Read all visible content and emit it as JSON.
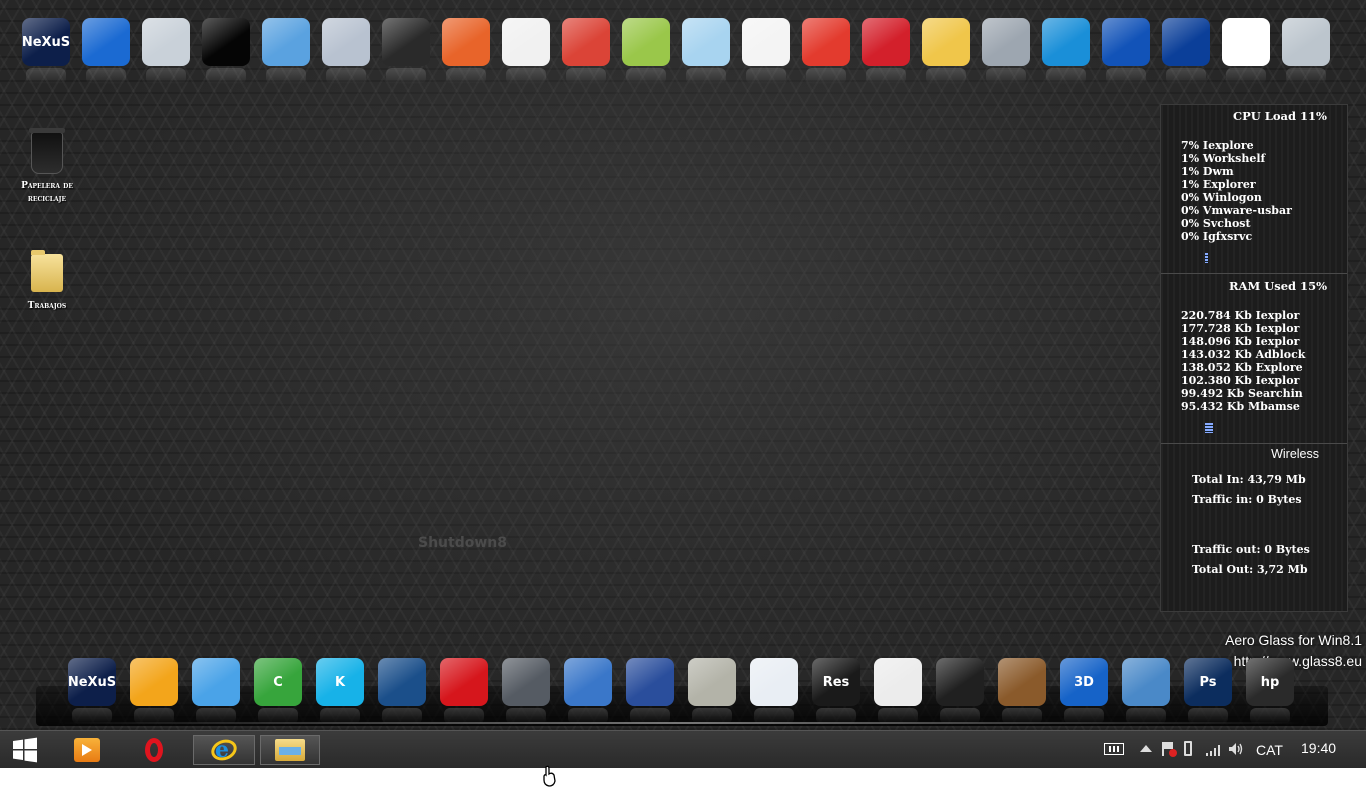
{
  "top_dock": [
    {
      "name": "nexus-launcher",
      "label": "NeXuS",
      "bg": "#0d1f4a",
      "fg": "#ffffff"
    },
    {
      "name": "windows-logo",
      "label": "",
      "bg": "#1b6ad2",
      "fg": "#ffffff"
    },
    {
      "name": "computer-monitor",
      "label": "",
      "bg": "#c9d1d9",
      "fg": "#333"
    },
    {
      "name": "black-screen",
      "label": "",
      "bg": "#050505",
      "fg": "#fff"
    },
    {
      "name": "control-panel",
      "label": "",
      "bg": "#5aa2e0",
      "fg": "#fff"
    },
    {
      "name": "uninstall",
      "label": "",
      "bg": "#b8c2d0",
      "fg": "#c00"
    },
    {
      "name": "laptop",
      "label": "",
      "bg": "#2a2a2a",
      "fg": "#fff"
    },
    {
      "name": "vlc-cone",
      "label": "",
      "bg": "#e8642a",
      "fg": "#fff"
    },
    {
      "name": "mouse",
      "label": "",
      "bg": "#f1f1f1",
      "fg": "#c00"
    },
    {
      "name": "chrome",
      "label": "",
      "bg": "#db4437",
      "fg": "#fff"
    },
    {
      "name": "notepad-plus",
      "label": "",
      "bg": "#9ac74a",
      "fg": "#fff"
    },
    {
      "name": "notepad",
      "label": "",
      "bg": "#a8d4f0",
      "fg": "#fff"
    },
    {
      "name": "blank-document",
      "label": "",
      "bg": "#f4f4f4",
      "fg": "#fff"
    },
    {
      "name": "ccleaner",
      "label": "",
      "bg": "#e33b2e",
      "fg": "#fff"
    },
    {
      "name": "lego-brick",
      "label": "",
      "bg": "#d3202b",
      "fg": "#fff"
    },
    {
      "name": "magic-wand",
      "label": "",
      "bg": "#f0c64a",
      "fg": "#fff"
    },
    {
      "name": "hard-disk",
      "label": "",
      "bg": "#9da6b0",
      "fg": "#fff"
    },
    {
      "name": "sync-circle",
      "label": "",
      "bg": "#1a8fd8",
      "fg": "#fff"
    },
    {
      "name": "remote-desktop",
      "label": "",
      "bg": "#1253b8",
      "fg": "#fff"
    },
    {
      "name": "malwarebytes",
      "label": "",
      "bg": "#0b3f99",
      "fg": "#fff"
    },
    {
      "name": "panda",
      "label": "",
      "bg": "#ffffff",
      "fg": "#000"
    },
    {
      "name": "clock-settings",
      "label": "",
      "bg": "#bcc5cd",
      "fg": "#333"
    }
  ],
  "desktop_icons": {
    "trash_label": "Papelera de reciclaje",
    "folder_label": "Trabajos"
  },
  "gadget": {
    "cpu_title": "CPU Load 11%",
    "cpu_processes": [
      "7% Iexplore",
      "1% Workshelf",
      "1% Dwm",
      "1% Explorer",
      "0% Winlogon",
      "0% Vmware-usbar",
      "0% Svchost",
      "0% Igfxsrvc"
    ],
    "ram_title": "RAM Used 15%",
    "ram_processes": [
      "220.784 Kb Iexplor",
      "177.728 Kb Iexplor",
      "148.096 Kb Iexplor",
      "143.032 Kb Adblock",
      "138.052 Kb Explore",
      "102.380 Kb Iexplor",
      "99.492 Kb Searchin",
      "95.432 Kb Mbamse"
    ],
    "net_title": "Wireless",
    "total_in": "Total In: 43,79 Mb",
    "traffic_in": "Traffic in: 0 Bytes",
    "traffic_out": "Traffic out: 0 Bytes",
    "total_out": "Total Out: 3,72 Mb"
  },
  "shutdown_label": "Shutdown8",
  "aero_note": {
    "line1": "Aero Glass for Win8.1",
    "line2": "http://www.glass8.eu"
  },
  "bottom_dock": [
    {
      "name": "nexus-launcher-2",
      "label": "NeXuS",
      "bg": "#0d1f4a"
    },
    {
      "name": "vmware",
      "label": "",
      "bg": "#f3a51b"
    },
    {
      "name": "photo-collage",
      "label": "",
      "bg": "#4aa3e8"
    },
    {
      "name": "camtasia",
      "label": "C",
      "bg": "#37a53c"
    },
    {
      "name": "kodi",
      "label": "K",
      "bg": "#17b2e8"
    },
    {
      "name": "movie-maker",
      "label": "",
      "bg": "#1b4f8a"
    },
    {
      "name": "power-button",
      "label": "",
      "bg": "#d6161c"
    },
    {
      "name": "usb-drive",
      "label": "",
      "bg": "#555b63"
    },
    {
      "name": "aimp-player",
      "label": "",
      "bg": "#3a77c9"
    },
    {
      "name": "media-sphere",
      "label": "",
      "bg": "#2a4e9c"
    },
    {
      "name": "toolbox",
      "label": "",
      "bg": "#b3b3a8"
    },
    {
      "name": "color-window",
      "label": "",
      "bg": "#e9eef4"
    },
    {
      "name": "reshacker",
      "label": "Res",
      "bg": "#1a1a1a"
    },
    {
      "name": "text-editor",
      "label": "",
      "bg": "#ececec"
    },
    {
      "name": "brush-tool",
      "label": "",
      "bg": "#202020"
    },
    {
      "name": "disc-burner",
      "label": "",
      "bg": "#8a5a2b"
    },
    {
      "name": "3d-text",
      "label": "3D",
      "bg": "#1663c8"
    },
    {
      "name": "camera-snapshot",
      "label": "",
      "bg": "#4a89c8"
    },
    {
      "name": "photoshop",
      "label": "Ps",
      "bg": "#0c2d5e"
    },
    {
      "name": "hp-logo",
      "label": "hp",
      "bg": "#2a2a2a"
    }
  ],
  "taskbar": {
    "language": "CAT",
    "time": "19:40"
  }
}
